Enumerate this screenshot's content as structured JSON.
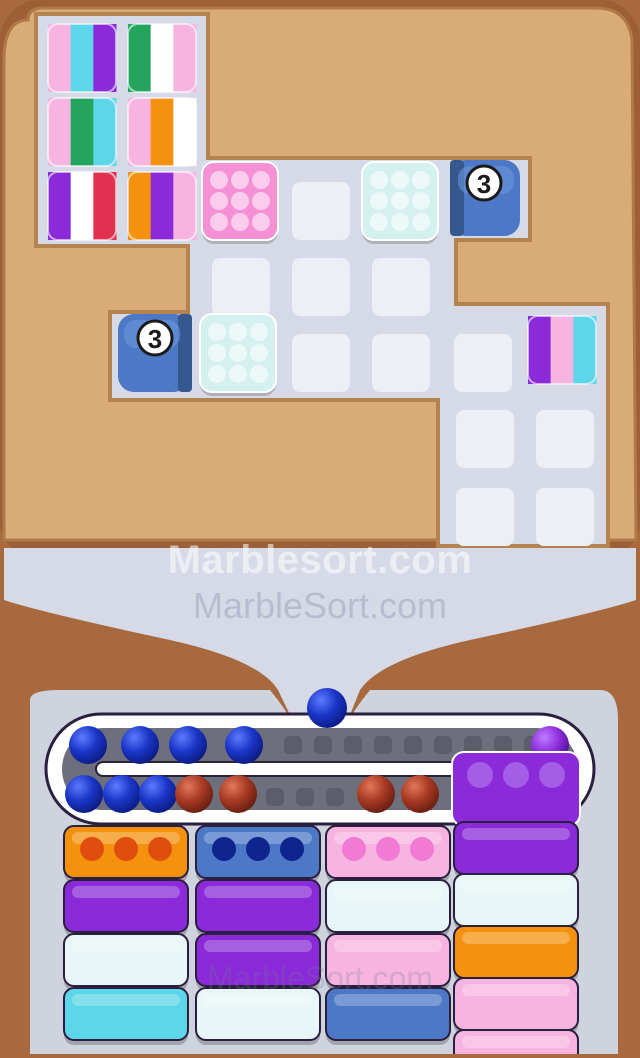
{
  "watermark": {
    "primary": "Marblesort.com",
    "secondary": "MarbleSort.com",
    "tertiary": "MarbleSort.com"
  },
  "colors": {
    "background": "#a8693e",
    "board": "#d8ab78",
    "field": "#d6dae6",
    "slot": "#eceff6",
    "pink": "#f58fd6",
    "white": "#d4f1ef",
    "blue": "#4d78c6",
    "purple": "#8a2ad8",
    "orange": "#f4920e",
    "light_pink": "#f7b4e0",
    "cyan": "#5dd6e9",
    "green": "#23a55e",
    "red": "#e33050",
    "marble_blue": "#1b36c8",
    "marble_red": "#a93a24"
  },
  "launchers": [
    {
      "id": "top",
      "count": "3"
    },
    {
      "id": "left",
      "count": "3"
    }
  ],
  "queue": {
    "dropping_marble": "blue",
    "track_top": [
      "blue",
      "blue",
      "blue",
      "blue",
      "empty",
      "empty",
      "empty",
      "empty",
      "empty",
      "empty",
      "empty",
      "empty",
      "empty",
      "purple"
    ],
    "track_bottom": [
      "blue",
      "blue",
      "blue",
      "red",
      "red",
      "empty",
      "empty",
      "empty",
      "red",
      "red"
    ]
  },
  "trays": [
    {
      "column": 1,
      "layers": [
        "orange",
        "purple",
        "white",
        "cyan"
      ]
    },
    {
      "column": 2,
      "layers": [
        "blue",
        "purple",
        "purple",
        "white"
      ]
    },
    {
      "column": 3,
      "layers": [
        "light_pink",
        "white",
        "light_pink",
        "blue"
      ]
    },
    {
      "column": 4,
      "layers": [
        "purple",
        "white",
        "orange",
        "light_pink",
        "light_pink"
      ]
    }
  ]
}
